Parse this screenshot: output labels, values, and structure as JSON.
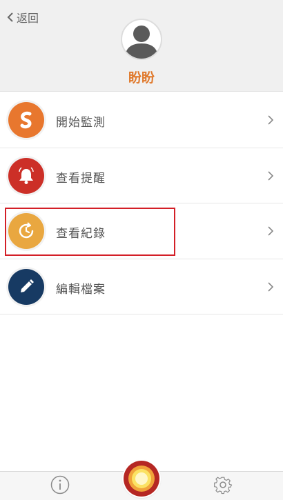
{
  "header": {
    "back_label": "返回",
    "profile_name": "盼盼"
  },
  "menu": {
    "items": [
      {
        "label": "開始監測",
        "icon": "s-logo-icon",
        "color": "#e8772e"
      },
      {
        "label": "查看提醒",
        "icon": "bell-icon",
        "color": "#cc2f27"
      },
      {
        "label": "查看紀錄",
        "icon": "history-clock-icon",
        "color": "#e9a740"
      },
      {
        "label": "編輯檔案",
        "icon": "pencil-icon",
        "color": "#173a63"
      }
    ]
  },
  "tabbar": {
    "items": [
      {
        "icon": "info-icon"
      },
      {
        "icon": "record-button-icon"
      },
      {
        "icon": "gear-icon"
      }
    ]
  },
  "colors": {
    "accent": "#e07a2e",
    "highlight_border": "#d31f27"
  }
}
